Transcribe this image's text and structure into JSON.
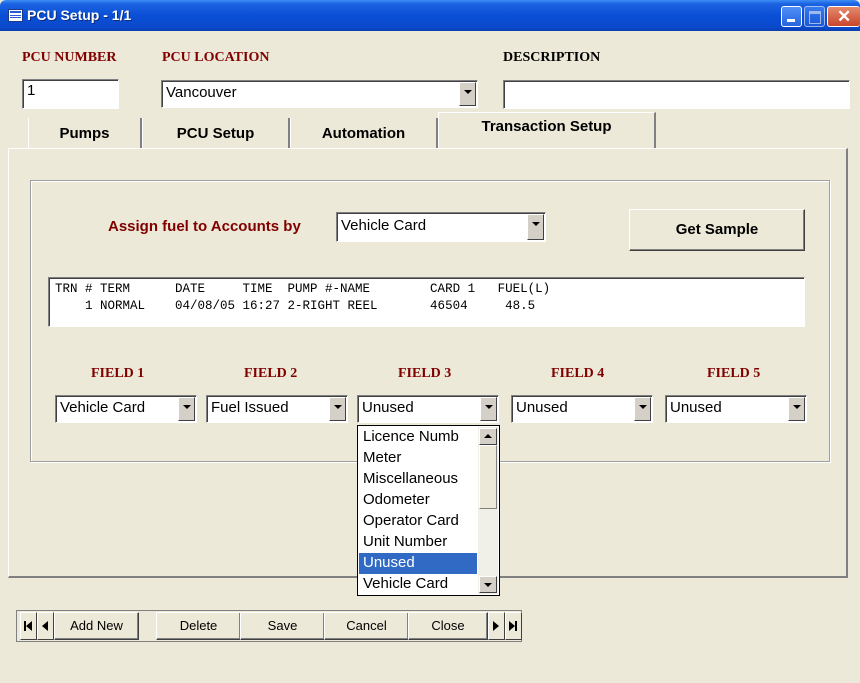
{
  "window": {
    "title": "PCU Setup - 1/1"
  },
  "header": {
    "pcu_number_label": "PCU NUMBER",
    "pcu_number_value": "1",
    "pcu_location_label": "PCU LOCATION",
    "pcu_location_value": "Vancouver",
    "description_label": "DESCRIPTION",
    "description_value": ""
  },
  "tabs": [
    {
      "label": "Pumps",
      "active": false
    },
    {
      "label": "PCU Setup",
      "active": false
    },
    {
      "label": "Automation",
      "active": false
    },
    {
      "label": "Transaction Setup",
      "active": true
    }
  ],
  "transaction": {
    "assign_label": "Assign fuel to Accounts by",
    "assign_value": "Vehicle Card",
    "get_sample_label": "Get Sample",
    "sample_lines": [
      "TRN # TERM      DATE     TIME  PUMP #-NAME        CARD 1   FUEL(L)",
      "    1 NORMAL    04/08/05 16:27 2-RIGHT REEL       46504     48.5"
    ],
    "fields": [
      {
        "label": "FIELD 1",
        "value": "Vehicle Card"
      },
      {
        "label": "FIELD 2",
        "value": "Fuel Issued"
      },
      {
        "label": "FIELD 3",
        "value": "Unused"
      },
      {
        "label": "FIELD 4",
        "value": "Unused"
      },
      {
        "label": "FIELD 5",
        "value": "Unused"
      }
    ],
    "dropdown_options": [
      "Licence Numb",
      "Meter",
      "Miscellaneous",
      "Odometer",
      "Operator Card",
      "Unit Number",
      "Unused",
      "Vehicle Card"
    ],
    "dropdown_selected": "Unused"
  },
  "navigation": {
    "add_new": "Add New",
    "delete": "Delete",
    "save": "Save",
    "cancel": "Cancel",
    "close": "Close"
  },
  "colors": {
    "label_accent": "#800000",
    "selection": "#316ac5",
    "titlebar": "#0a4fd6"
  }
}
